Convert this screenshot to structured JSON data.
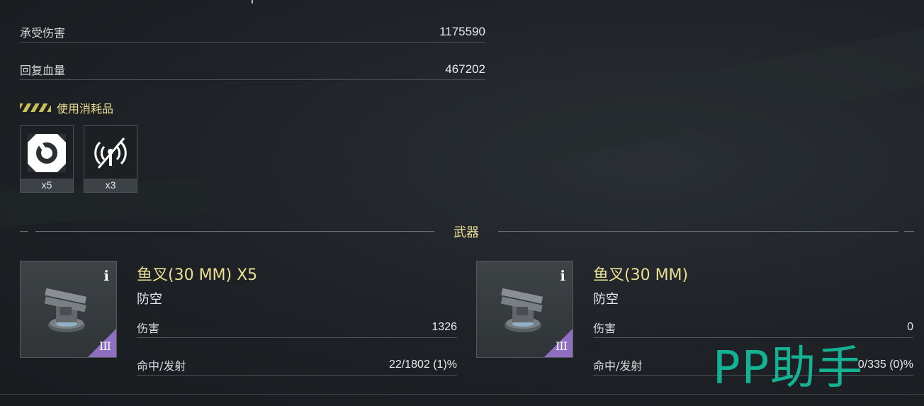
{
  "stats": [
    {
      "label": "承受伤害",
      "value": "1175590"
    },
    {
      "label": "回复血量",
      "value": "467202"
    }
  ],
  "consumables": {
    "title": "使用消耗品",
    "items": [
      {
        "icon": "repair-party-icon",
        "count": "x5"
      },
      {
        "icon": "radar-signal-icon",
        "count": "x3"
      }
    ]
  },
  "weapons_section": {
    "title": "武器",
    "items": [
      {
        "name": "鱼叉(30 MM) X5",
        "type": "防空",
        "tier": "III",
        "info": "i",
        "rows": [
          {
            "label": "伤害",
            "value": "1326"
          },
          {
            "label": "命中/发射",
            "value": "22/1802 (1)%"
          }
        ]
      },
      {
        "name": "鱼叉(30 MM)",
        "type": "防空",
        "tier": "III",
        "info": "i",
        "rows": [
          {
            "label": "伤害",
            "value": "0"
          },
          {
            "label": "命中/发射",
            "value": "0/335 (0)%"
          }
        ]
      }
    ]
  },
  "watermark": "PP助手",
  "colors": {
    "accent": "#eadf92",
    "tier": "#8e6fc2",
    "watermark": "#12c2a0"
  }
}
